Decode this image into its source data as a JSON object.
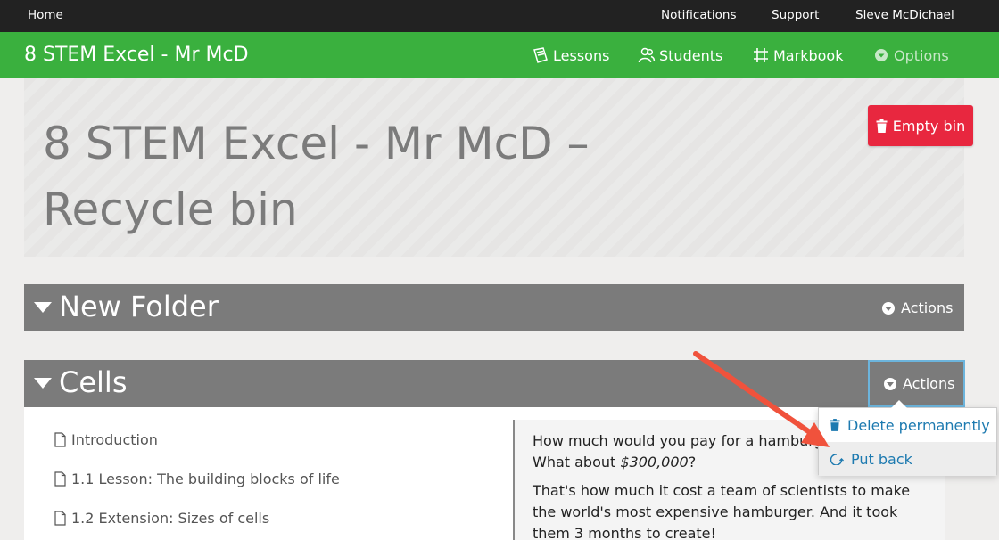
{
  "topbar": {
    "home": "Home",
    "notifications": "Notifications",
    "support": "Support",
    "user": "Sleve McDichael"
  },
  "nav": {
    "brand": "8 STEM Excel - Mr McD",
    "lessons": "Lessons",
    "students": "Students",
    "markbook": "Markbook",
    "options": "Options"
  },
  "header": {
    "title": "8 STEM Excel - Mr McD – Recycle bin",
    "empty_bin": "Empty bin"
  },
  "folders": [
    {
      "name": "New Folder",
      "actions": "Actions"
    },
    {
      "name": "Cells",
      "actions": "Actions"
    }
  ],
  "lessons": [
    "Introduction",
    "1.1 Lesson: The building blocks of life",
    "1.2 Extension: Sizes of cells"
  ],
  "preview": {
    "line1": "How much would you pay for a hamburger?",
    "line2_prefix": "What about ",
    "line2_em": "$300,000",
    "line2_suffix": "?",
    "para2": "That's how much it cost a team of scientists to make the world's most expensive hamburger. And it took them 3 months to create!"
  },
  "menu": {
    "delete": "Delete permanently",
    "put_back": "Put back"
  },
  "colors": {
    "green": "#3ab03e",
    "danger": "#e8273f",
    "link": "#1d7ab0",
    "arrow": "#f0523c"
  }
}
